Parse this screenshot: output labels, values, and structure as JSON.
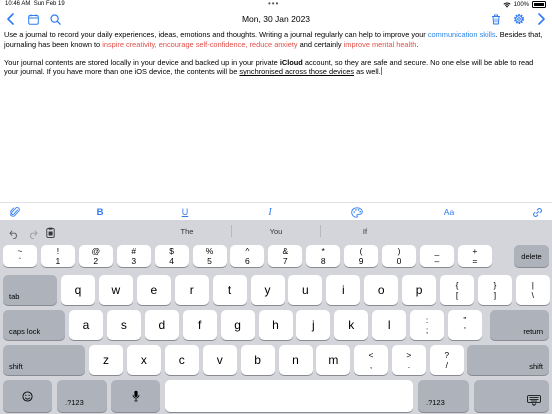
{
  "status": {
    "time": "10:46 AM",
    "date": "Sun Feb 19",
    "battery": "100%"
  },
  "nav": {
    "title": "Mon, 30 Jan 2023"
  },
  "content": {
    "p1": [
      {
        "t": "Use a journal to record your daily experiences, ideas, emotions and thoughts. Writing a journal regularly can help to improve your ",
        "s": ""
      },
      {
        "t": "communication skills",
        "s": "blue"
      },
      {
        "t": ". Besides that, journaling has been known to ",
        "s": ""
      },
      {
        "t": "inspire creativity, encourage self-confidence, reduce anxiety",
        "s": "red"
      },
      {
        "t": " and certainly ",
        "s": ""
      },
      {
        "t": "improve mental health",
        "s": "red"
      },
      {
        "t": ".",
        "s": ""
      }
    ],
    "p2": [
      {
        "t": "Your journal contents are stored locally in your device and backed up in your private ",
        "s": ""
      },
      {
        "t": "iCloud",
        "s": "bold"
      },
      {
        "t": " account, so they are safe and secure. No one else will be able to read your journal. If you have more than one iOS device, the contents will be ",
        "s": ""
      },
      {
        "t": "synchronised across those devices",
        "s": "ul"
      },
      {
        "t": " as well.",
        "s": ""
      }
    ]
  },
  "format_toolbar": {
    "bold": "B",
    "underline": "U",
    "italic": "I",
    "text_size": "Aa"
  },
  "keyboard": {
    "predictions": [
      "The",
      "You",
      "If"
    ],
    "num_row": [
      {
        "top": "~",
        "bottom": "`"
      },
      {
        "top": "!",
        "bottom": "1"
      },
      {
        "top": "@",
        "bottom": "2"
      },
      {
        "top": "#",
        "bottom": "3"
      },
      {
        "top": "$",
        "bottom": "4"
      },
      {
        "top": "%",
        "bottom": "5"
      },
      {
        "top": "^",
        "bottom": "6"
      },
      {
        "top": "&",
        "bottom": "7"
      },
      {
        "top": "*",
        "bottom": "8"
      },
      {
        "top": "(",
        "bottom": "9"
      },
      {
        "top": ")",
        "bottom": "0"
      },
      {
        "top": "_",
        "bottom": "–"
      },
      {
        "top": "+",
        "bottom": "="
      }
    ],
    "delete": "delete",
    "tab": "tab",
    "row_q": [
      "q",
      "w",
      "e",
      "r",
      "t",
      "y",
      "u",
      "i",
      "o",
      "p"
    ],
    "row_q_extra": [
      {
        "top": "{",
        "bottom": "["
      },
      {
        "top": "}",
        "bottom": "]"
      },
      {
        "top": "|",
        "bottom": "\\"
      }
    ],
    "caps": "caps lock",
    "row_a": [
      "a",
      "s",
      "d",
      "f",
      "g",
      "h",
      "j",
      "k",
      "l"
    ],
    "row_a_extra": [
      {
        "top": ":",
        "bottom": ";"
      },
      {
        "top": "\"",
        "bottom": "'"
      }
    ],
    "return": "return",
    "shift": "shift",
    "row_z": [
      "z",
      "x",
      "c",
      "v",
      "b",
      "n",
      "m"
    ],
    "row_z_extra": [
      {
        "top": "<",
        "bottom": ","
      },
      {
        "top": ">",
        "bottom": "."
      },
      {
        "top": "?",
        "bottom": "/"
      }
    ],
    "num_switch": ".?123"
  }
}
